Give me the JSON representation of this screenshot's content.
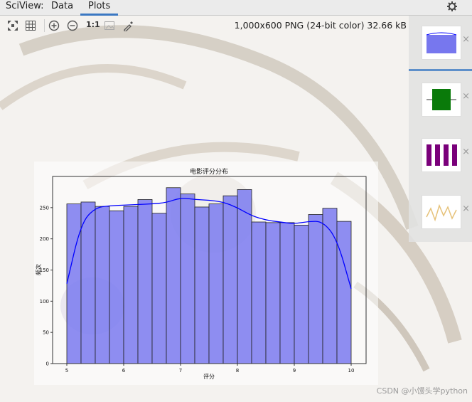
{
  "tabs": {
    "title": "SciView:",
    "data_tab": "Data",
    "plots_tab": "Plots"
  },
  "image_info": "1,000x600 PNG (24-bit color) 32.66 kB",
  "toolbar": {
    "icons": [
      "fit-screen-icon",
      "grid-icon",
      "zoom-in-icon",
      "zoom-out-icon",
      "actual-size-icon",
      "background-icon",
      "color-picker-icon"
    ],
    "actual_size_label": "1:1"
  },
  "thumbnails": [
    {
      "kind": "histogram",
      "color": "#7777ee",
      "close": "×"
    },
    {
      "kind": "boxplot",
      "color": "#0a7a0a",
      "close": "×"
    },
    {
      "kind": "bars",
      "color": "#7a007a",
      "close": "×"
    },
    {
      "kind": "line",
      "color": "#e6c27a",
      "close": "×"
    }
  ],
  "watermark": "CSDN @小馒头学python",
  "chart_data": {
    "type": "bar",
    "title": "电影评分分布",
    "xlabel": "评分",
    "ylabel": "频次",
    "xlim": [
      5,
      10
    ],
    "ylim": [
      0,
      300
    ],
    "bins": [
      [
        5.0,
        5.25
      ],
      [
        5.25,
        5.5
      ],
      [
        5.5,
        5.75
      ],
      [
        5.75,
        6.0
      ],
      [
        6.0,
        6.25
      ],
      [
        6.25,
        6.5
      ],
      [
        6.5,
        6.75
      ],
      [
        6.75,
        7.0
      ],
      [
        7.0,
        7.25
      ],
      [
        7.25,
        7.5
      ],
      [
        7.5,
        7.75
      ],
      [
        7.75,
        8.0
      ],
      [
        8.0,
        8.25
      ],
      [
        8.25,
        8.5
      ],
      [
        8.5,
        8.75
      ],
      [
        8.75,
        9.0
      ],
      [
        9.0,
        9.25
      ],
      [
        9.25,
        9.5
      ],
      [
        9.5,
        9.75
      ],
      [
        9.75,
        10.0
      ]
    ],
    "values": [
      256,
      259,
      252,
      245,
      252,
      263,
      241,
      282,
      272,
      251,
      256,
      269,
      279,
      227,
      226,
      226,
      222,
      239,
      249,
      228
    ],
    "kde": {
      "x": [
        5.0,
        5.25,
        5.5,
        5.75,
        6.0,
        6.25,
        6.5,
        6.75,
        7.0,
        7.25,
        7.5,
        7.75,
        8.0,
        8.25,
        8.5,
        8.75,
        9.0,
        9.25,
        9.5,
        9.75,
        10.0
      ],
      "y": [
        128,
        225,
        250,
        253,
        254,
        255,
        256,
        258,
        266,
        263,
        262,
        259,
        250,
        237,
        230,
        227,
        224,
        228,
        228,
        200,
        120
      ]
    },
    "xticks": [
      "5",
      "6",
      "7",
      "8",
      "9",
      "10"
    ],
    "yticks": [
      "0",
      "50",
      "100",
      "150",
      "200",
      "250"
    ],
    "bar_color": "#7a7af0",
    "kde_color": "#0000ff"
  }
}
